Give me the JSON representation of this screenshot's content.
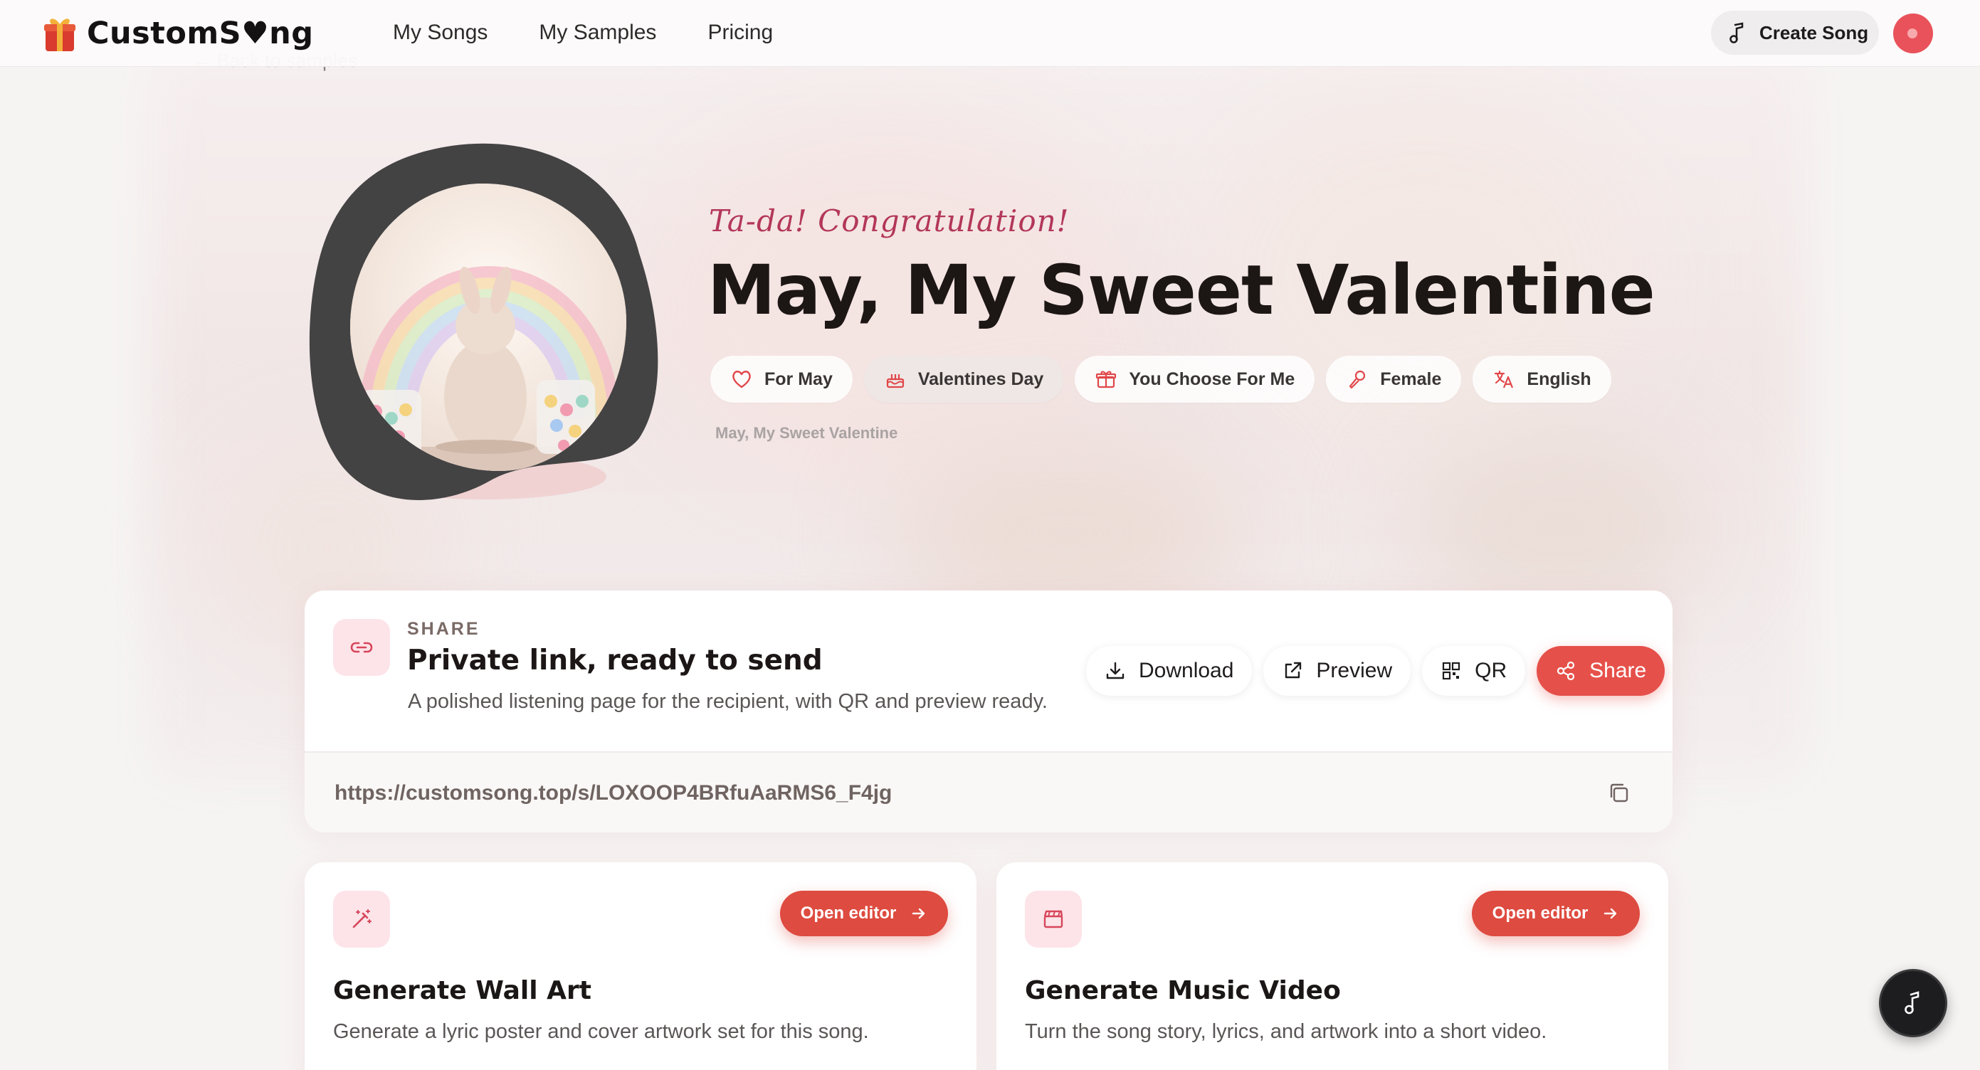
{
  "header": {
    "logo_text": "CustomS♥ng",
    "nav": [
      "My Songs",
      "My Samples",
      "Pricing"
    ],
    "create_button": "Create Song"
  },
  "back_link": "← Back to samples",
  "hero": {
    "tagline": "Ta-da! Congratulation!",
    "title": "May, My Sweet Valentine",
    "chips": [
      {
        "label": "For May",
        "icon": "heart-icon"
      },
      {
        "label": "Valentines Day",
        "icon": "cake-icon"
      },
      {
        "label": "You Choose For Me",
        "icon": "gift-icon"
      },
      {
        "label": "Female",
        "icon": "microphone-icon"
      },
      {
        "label": "English",
        "icon": "translate-icon"
      }
    ],
    "small_title": "May, My Sweet Valentine"
  },
  "share": {
    "eyebrow": "SHARE",
    "heading": "Private link, ready to send",
    "description": "A polished listening page for the recipient, with QR and preview ready.",
    "actions": {
      "download": "Download",
      "preview": "Preview",
      "qr": "QR",
      "share": "Share"
    },
    "url": "https://customsong.top/s/LOXOOP4BRfuAaRMS6_F4jg"
  },
  "tools": [
    {
      "icon": "magic-wand-icon",
      "button": "Open editor",
      "title": "Generate Wall Art",
      "description": "Generate a lyric poster and cover artwork set for this song."
    },
    {
      "icon": "clapperboard-icon",
      "button": "Open editor",
      "title": "Generate Music Video",
      "description": "Turn the song story, lyrics, and artwork into a short video."
    }
  ],
  "colors": {
    "accent": "#e6504a",
    "tagline": "#b3375a",
    "icon_tint": "#fde4e8"
  }
}
